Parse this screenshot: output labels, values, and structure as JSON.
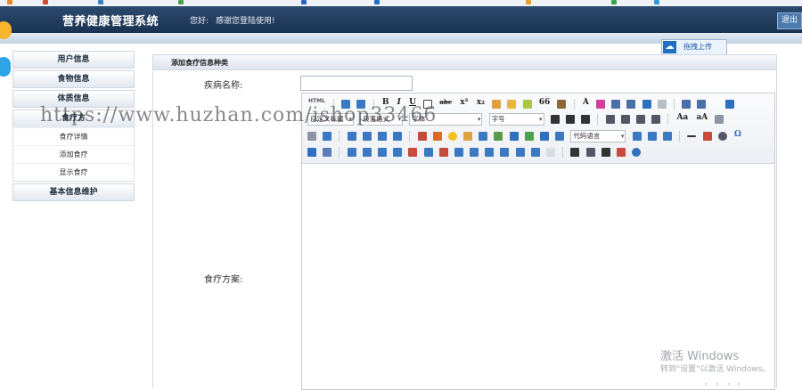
{
  "app": {
    "title": "营养健康管理系统",
    "welcome_prefix": "您好:",
    "welcome_text": "感谢您登陆使用!",
    "logout": "退出"
  },
  "upload": {
    "label": "拖拽上传",
    "icon": "cloud-icon"
  },
  "sidebar": {
    "sections": [
      "用户信息",
      "食物信息",
      "体质信息",
      "基本信息维护"
    ],
    "open_section": "食疗方",
    "sub_items": [
      "食疗详情",
      "添加食疗",
      "显示食疗"
    ]
  },
  "panel": {
    "title": "添加食疗信息种类",
    "disease_label": "疾病名称:",
    "disease_value": "",
    "plan_label": "食疗方案:"
  },
  "editor": {
    "paragraph_select": "段落格式",
    "custom_title_select": "自定义标题",
    "font_select": "字体",
    "size_select": "字号",
    "code_select": "代码语言",
    "html_btn": "HTML"
  },
  "watermark": {
    "url_text": "https://www.huzhan.com/ishop33466"
  },
  "windows": {
    "activate_title": "激活 Windows",
    "activate_hint": "转到\"设置\"以激活 Windows。"
  },
  "colors": {
    "header": "#1b3352",
    "accent": "#1f6fc4"
  }
}
